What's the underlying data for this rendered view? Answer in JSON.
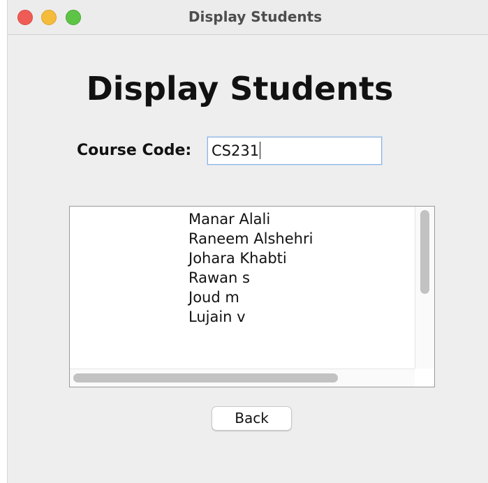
{
  "window": {
    "title": "Display Students"
  },
  "main": {
    "heading": "Display Students",
    "course_code_label": "Course Code:",
    "course_code_value": "CS231",
    "students": [
      "Manar Alali",
      "Raneem Alshehri",
      "Johara Khabti",
      "Rawan s",
      "Joud m",
      "Lujain v"
    ],
    "back_label": "Back"
  },
  "colors": {
    "close": "#ee5c55",
    "minimize": "#f5bc3b",
    "maximize": "#5ec447",
    "input_focus": "#8fb3e0"
  }
}
